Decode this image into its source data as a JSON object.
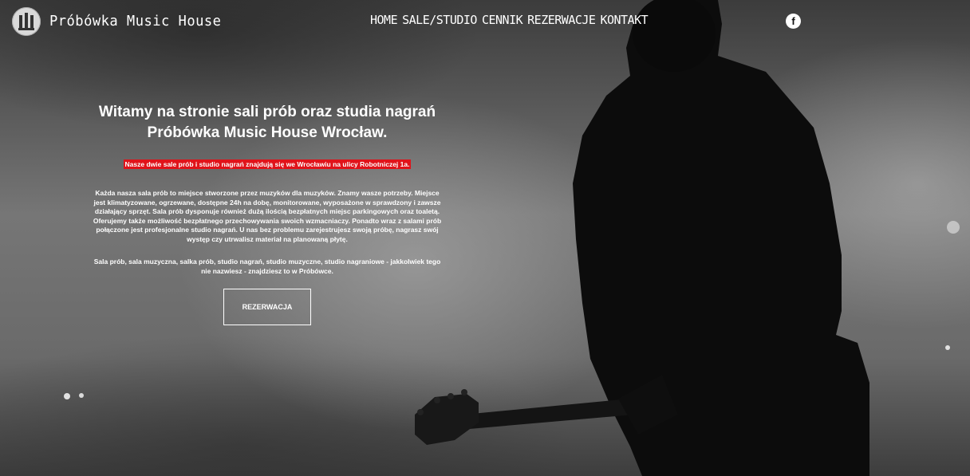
{
  "brand": {
    "name": "Próbówka Music House"
  },
  "nav": {
    "items": [
      {
        "label": "Home"
      },
      {
        "label": "Sale/Studio"
      },
      {
        "label": "Cennik"
      },
      {
        "label": "Rezerwacje"
      },
      {
        "label": "Kontakt"
      }
    ]
  },
  "social": {
    "facebook_glyph": "f",
    "icon": "facebook-icon"
  },
  "hero": {
    "headline_line1": "Witamy na stronie sali prób oraz studia nagrań",
    "headline_line2": "Próbówka Music House Wrocław.",
    "highlight": "Nasze dwie sale prób i studio nagrań znajdują się we Wrocławiu na ulicy Robotniczej 1a.",
    "paragraph1": "Każda nasza sala prób to miejsce stworzone przez muzyków dla muzyków. Znamy wasze potrzeby. Miejsce jest klimatyzowane, ogrzewane, dostępne 24h na dobę, monitorowane, wyposażone w sprawdzony i zawsze działający sprzęt. Sala prób dysponuje również dużą ilością bezpłatnych miejsc parkingowych oraz toaletą. Oferujemy także możliwość bezpłatnego przechowywania swoich wzmacniaczy. Ponadto wraz z salami prób połączone jest profesjonalne studio nagrań. U nas bez problemu zarejestrujesz swoją próbę, nagrasz swój występ czy utrwalisz materiał na planowaną płytę.",
    "paragraph2": "Sala prób, sala muzyczna, salka prób, studio nagrań, studio muzyczne, studio nagraniowe - jakkolwiek tego nie nazwiesz - znajdziesz to w Próbówce.",
    "button_label": "REZERWACJA"
  },
  "colors": {
    "highlight_bg": "#e0131a",
    "text": "#ffffff"
  }
}
